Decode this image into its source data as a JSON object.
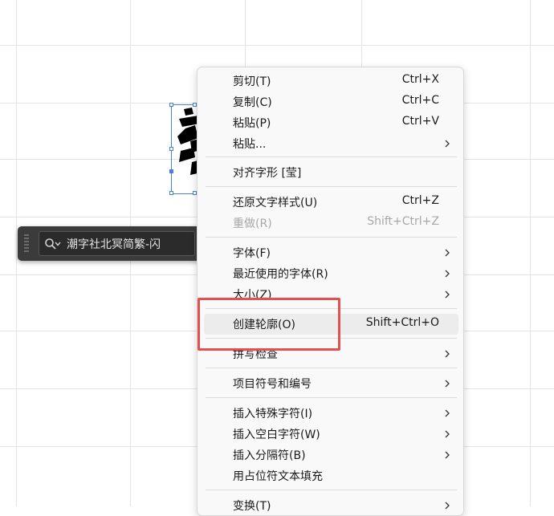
{
  "control_bar": {
    "font_name": "潮字社北冥简繁-闪"
  },
  "context_menu": {
    "items": [
      {
        "label": "剪切(T)",
        "shortcut": "Ctrl+X"
      },
      {
        "label": "复制(C)",
        "shortcut": "Ctrl+C"
      },
      {
        "label": "粘贴(P)",
        "shortcut": "Ctrl+V"
      },
      {
        "label": "粘贴...",
        "shortcut": ""
      },
      {
        "label": "对齐字形 [莹]",
        "shortcut": ""
      },
      {
        "label": "还原文字样式(U)",
        "shortcut": "Ctrl+Z"
      },
      {
        "label": "重做(R)",
        "shortcut": "Shift+Ctrl+Z"
      },
      {
        "label": "字体(F)",
        "shortcut": ""
      },
      {
        "label": "最近使用的字体(R)",
        "shortcut": ""
      },
      {
        "label": "大小(Z)",
        "shortcut": ""
      },
      {
        "label": "创建轮廓(O)",
        "shortcut": "Shift+Ctrl+O"
      },
      {
        "label": "拼写检查",
        "shortcut": ""
      },
      {
        "label": "项目符号和编号",
        "shortcut": ""
      },
      {
        "label": "插入特殊字符(I)",
        "shortcut": ""
      },
      {
        "label": "插入空白字符(W)",
        "shortcut": ""
      },
      {
        "label": "插入分隔符(B)",
        "shortcut": ""
      },
      {
        "label": "用占位符文本填充",
        "shortcut": ""
      },
      {
        "label": "变换(T)",
        "shortcut": ""
      }
    ]
  },
  "colors": {
    "annotation": "#e2504f",
    "selection": "#4a7fe0",
    "menu_highlight": "#ececec"
  }
}
